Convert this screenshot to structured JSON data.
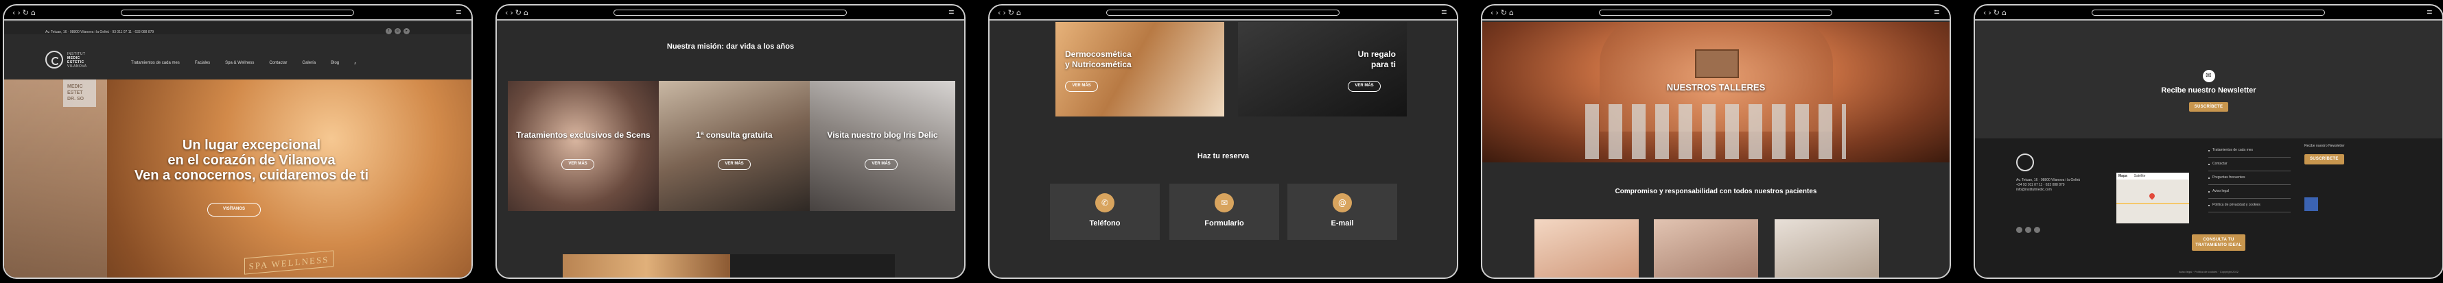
{
  "browser": {
    "menu_icon": "hamburger-icon"
  },
  "panel1": {
    "contact_line": "Av. Tetuan, 16 · 08800 Vilanova i la Geltrú · 93 011 07 11 · 633 088 879",
    "logo": [
      "INSTITUT",
      "MEDIC",
      "ESTETIC",
      "VILANOVA"
    ],
    "menu": [
      "Tratamientos de cada mes",
      "Faciales",
      "Spa & Wellness",
      "Contactar",
      "Galería",
      "Blog"
    ],
    "hero_lines": [
      "Un lugar excepcional",
      "en el corazón de Vilanova",
      "Ven a conocernos, cuidaremos de ti"
    ],
    "hero_button": "VISÍTANOS",
    "hero_sign": "SPA WELLNESS",
    "wall_logo": [
      "MEDIC",
      "ESTET",
      "DR. SO"
    ]
  },
  "panel2": {
    "title": "Nuestra misión: dar vida a los años",
    "cards": [
      {
        "caption": "Tratamientos exclusivos de Scens",
        "button": "VER MÁS"
      },
      {
        "caption": "1ª consulta gratuita",
        "button": "VER MÁS"
      },
      {
        "caption": "Visita nuestro blog Iris Delic",
        "button": "VER MÁS"
      }
    ]
  },
  "panel3": {
    "tile_left": {
      "caption_1": "Dermocosmética",
      "caption_2": "y Nutricosmética",
      "button": "VER MÁS"
    },
    "tile_right": {
      "caption_1": "Un regalo",
      "caption_2": "para ti",
      "button": "VER MÁS"
    },
    "reserve_title": "Haz tu reserva",
    "contacts": [
      {
        "label": "Teléfono",
        "icon": "phone-icon",
        "glyph": "✆"
      },
      {
        "label": "Formulario",
        "icon": "form-icon",
        "glyph": "✉"
      },
      {
        "label": "E-mail",
        "icon": "email-icon",
        "glyph": "@"
      }
    ]
  },
  "panel4": {
    "hero_title": "NUESTROS TALLERES",
    "commit_title": "Compromiso y responsabilidad con todos nuestros pacientes"
  },
  "panel5": {
    "newsletter_title": "Recibe nuestro Newsletter",
    "newsletter_button": "SUSCRÍBETE",
    "address": [
      "Av. Tetuan, 16 · 08800 Vilanova i la Geltrú",
      "+34 93 011 07 11 · 633 088 879",
      "info@institutmedic.com"
    ],
    "links": [
      "Tratamientos de cada mes",
      "Contactar",
      "Preguntas frecuentes",
      "Aviso legal",
      "Política de privacidad y cookies"
    ],
    "map_tabs": [
      "Mapa",
      "Satélite"
    ],
    "side_title": "Recibe nuestro Newsletter",
    "side_button": "SUSCRÍBETE",
    "cta_button": "CONSULTA TU TRATAMIENTO IDEAL",
    "copyright": "Aviso legal · Política de cookies · Copyright 2022"
  },
  "colors": {
    "accent": "#c8964e",
    "bg": "#2b2b2b",
    "footer": "#1d1d1d"
  }
}
